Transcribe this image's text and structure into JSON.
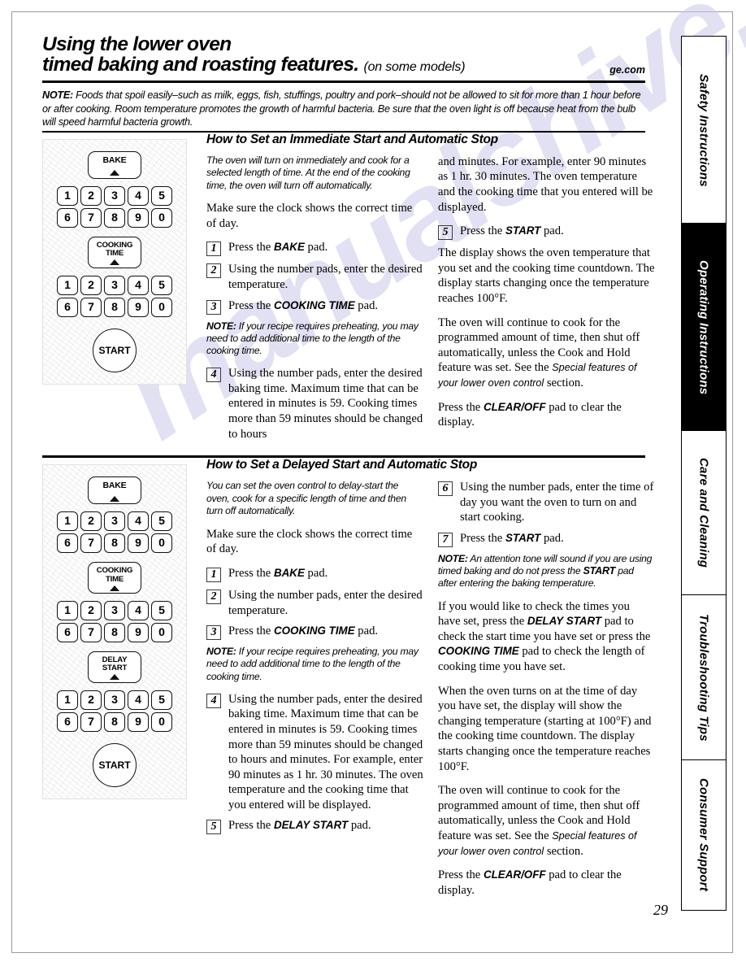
{
  "header": {
    "title_line1": "Using the lower oven",
    "title_line2": "timed baking and roasting features.",
    "subtitle": "(on some models)",
    "site": "ge.com"
  },
  "top_note": {
    "label": "NOTE:",
    "text": " Foods that spoil easily–such as milk, eggs, fish, stuffings, poultry and pork–should not be allowed to sit for more than 1 hour before or after cooking. Room temperature promotes the growth of harmful bacteria. Be sure that the oven light is off because heat from the bulb will speed harmful bacteria growth."
  },
  "watermark": "manualshive.com",
  "control_panel": {
    "bake_label": "BAKE",
    "cooking_time_line1": "COOKING",
    "cooking_time_line2": "TIME",
    "delay_start_line1": "DELAY",
    "delay_start_line2": "START",
    "start_label": "START",
    "keys_row1": [
      "1",
      "2",
      "3",
      "4",
      "5"
    ],
    "keys_row2": [
      "6",
      "7",
      "8",
      "9",
      "0"
    ]
  },
  "section1": {
    "heading": "How to Set an Immediate Start and Automatic Stop",
    "intro": "The oven will turn on immediately and cook for a selected length of time. At the end of the cooking time, the oven will turn off automatically.",
    "clock_para": "Make sure the clock shows the correct time of day.",
    "step1_num": "1",
    "step1_pre": "Press the ",
    "step1_pad": "BAKE",
    "step1_post": " pad.",
    "step2_num": "2",
    "step2_text": "Using the number pads, enter the desired temperature.",
    "step3_num": "3",
    "step3_pre": "Press the ",
    "step3_pad": "COOKING TIME",
    "step3_post": " pad.",
    "note_label": "NOTE:",
    "note_text": " If your recipe requires preheating, you may need to add additional time to the length of the cooking time.",
    "step4_num": "4",
    "step4_text": "Using the number pads, enter the desired baking time. Maximum time that can be entered in minutes is 59. Cooking times more than 59 minutes should be changed to hours",
    "col2_continued": "and minutes. For example, enter 90 minutes as 1 hr. 30 minutes. The oven temperature and the cooking time that you entered will be displayed.",
    "step5_num": "5",
    "step5_pre": "Press the ",
    "step5_pad": "START",
    "step5_post": " pad.",
    "para_display": "The display shows the oven temperature that you set and the cooking time countdown. The display starts changing once the temperature reaches 100°F.",
    "para_continue_pre": "The oven will continue to cook for the programmed amount of time, then shut off automatically, unless the Cook and Hold feature was set. See the ",
    "para_continue_italic": "Special features of your lower oven control",
    "para_continue_post": " section.",
    "para_clear_pre": "Press the ",
    "para_clear_pad": "CLEAR/OFF",
    "para_clear_post": " pad to clear the display."
  },
  "section2": {
    "heading": "How to Set a Delayed Start and Automatic Stop",
    "intro": "You can set the oven control to delay-start the oven, cook for a specific length of time and then turn off automatically.",
    "clock_para": "Make sure the clock shows the correct time of day.",
    "step1_num": "1",
    "step1_pre": "Press the ",
    "step1_pad": "BAKE",
    "step1_post": " pad.",
    "step2_num": "2",
    "step2_text": "Using the number pads, enter the desired temperature.",
    "step3_num": "3",
    "step3_pre": "Press the ",
    "step3_pad": "COOKING TIME",
    "step3_post": " pad.",
    "note_label": "NOTE:",
    "note_text": " If your recipe requires preheating, you may need to add additional time to the length of the cooking time.",
    "step4_num": "4",
    "step4_text": "Using the number pads, enter the desired baking time. Maximum time that can be entered in minutes is 59. Cooking times more than 59 minutes should be changed to hours and minutes. For example, enter 90 minutes as 1 hr. 30 minutes. The oven temperature and the cooking time that you entered will be displayed.",
    "step5_num": "5",
    "step5_pre": "Press the ",
    "step5_pad": "DELAY START",
    "step5_post": " pad.",
    "step6_num": "6",
    "step6_text": "Using the number pads, enter the time of day you want the oven to turn on and start cooking.",
    "step7_num": "7",
    "step7_pre": "Press the ",
    "step7_pad": "START",
    "step7_post": " pad.",
    "note2_label": "NOTE:",
    "note2_pre": " An attention tone will sound if you are using timed baking and do not press the ",
    "note2_pad": "START",
    "note2_post": " pad after entering the baking temperature.",
    "para_check_pre": "If you would like to check the times you have set, press the ",
    "para_check_pad1": "DELAY START",
    "para_check_mid": " pad to check the start time you have set or press the ",
    "para_check_pad2": "COOKING TIME",
    "para_check_post": " pad to check the length of cooking time you have set.",
    "para_turnson": "When the oven turns on at the time of day you have set, the display will show the changing temperature (starting at 100°F) and the cooking time countdown. The display starts changing once the temperature reaches 100°F.",
    "para_continue_pre": "The oven will continue to cook for the programmed amount of time, then shut off automatically, unless the Cook and Hold feature was set. See the ",
    "para_continue_italic": "Special features of your lower oven control",
    "para_continue_post": " section.",
    "para_clear_pre": "Press the ",
    "para_clear_pad": "CLEAR/OFF",
    "para_clear_post": " pad to clear the display."
  },
  "tabs": [
    {
      "label": "Safety Instructions",
      "active": false
    },
    {
      "label": "Operating Instructions",
      "active": true
    },
    {
      "label": "Care and Cleaning",
      "active": false
    },
    {
      "label": "Troubleshooting Tips",
      "active": false
    },
    {
      "label": "Consumer Support",
      "active": false
    }
  ],
  "page_number": "29"
}
